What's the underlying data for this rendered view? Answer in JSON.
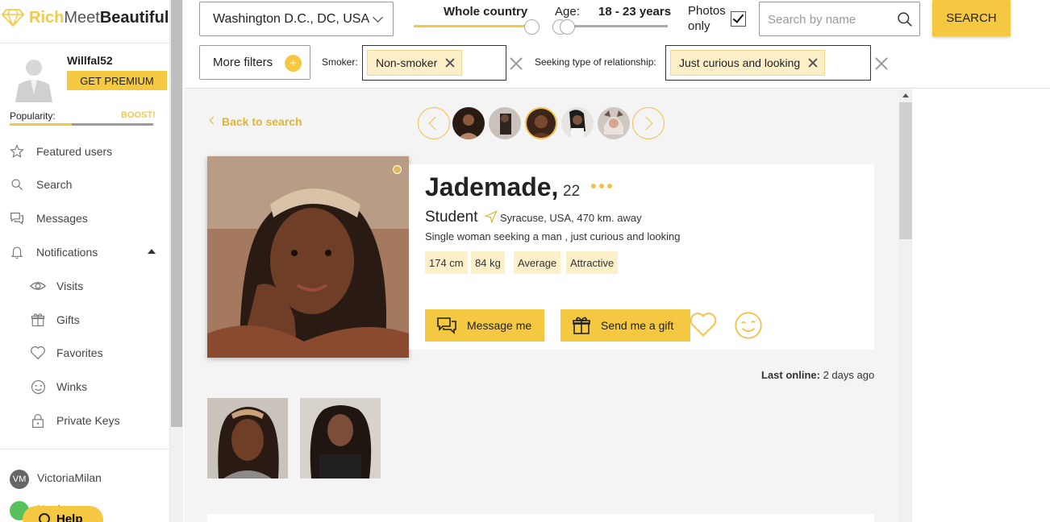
{
  "brand": {
    "part1": "Rich",
    "part2": "Meet",
    "part3": "Beautiful",
    "accent": "#f5c842"
  },
  "user": {
    "username": "Willfal52",
    "premium_label": "GET PREMIUM",
    "popularity_label": "Popularity:",
    "boost_label": "BOOST!",
    "popularity": 0.43
  },
  "sidebar": {
    "items": [
      {
        "label": "Featured users",
        "icon": "star-icon"
      },
      {
        "label": "Search",
        "icon": "search-icon"
      },
      {
        "label": "Messages",
        "icon": "chat-icon"
      },
      {
        "label": "Notifications",
        "icon": "bell-icon"
      }
    ],
    "sub_items": [
      {
        "label": "Visits",
        "icon": "eye-icon"
      },
      {
        "label": "Gifts",
        "icon": "gift-icon"
      },
      {
        "label": "Favorites",
        "icon": "heart-icon"
      },
      {
        "label": "Winks",
        "icon": "wink-icon"
      },
      {
        "label": "Private Keys",
        "icon": "lock-icon"
      }
    ],
    "partner": {
      "initials": "VM",
      "label": "VictoriaMilan"
    },
    "partial_label": "N...th",
    "help_label": "Help"
  },
  "filters": {
    "location": "Washington D.C., DC, USA",
    "distance_label": "Whole country",
    "age_label": "Age:",
    "age_value": "18 - 23 years",
    "photos_label": "Photos only",
    "photos_checked": true,
    "search_placeholder": "Search by name",
    "search_button": "SEARCH",
    "more_filters": "More filters",
    "more_filters_plus": "+",
    "smoker_label": "Smoker:",
    "smoker_chip": "Non-smoker",
    "relationship_label": "Seeking type of relationship:",
    "relationship_chip": "Just curious and looking"
  },
  "main": {
    "back_label": "Back to search",
    "profile": {
      "name": "Jademade,",
      "age": "22",
      "occupation": "Student",
      "location": "Syracuse, USA, 470 km. away",
      "seeking": "Single woman seeking a man , just curious and looking",
      "tags": [
        "174 cm",
        "84 kg",
        "Average",
        "Attractive"
      ],
      "message_button": "Message me",
      "gift_button": "Send me a gift",
      "last_online_label": "Last online:",
      "last_online_value": " 2 days ago"
    }
  }
}
